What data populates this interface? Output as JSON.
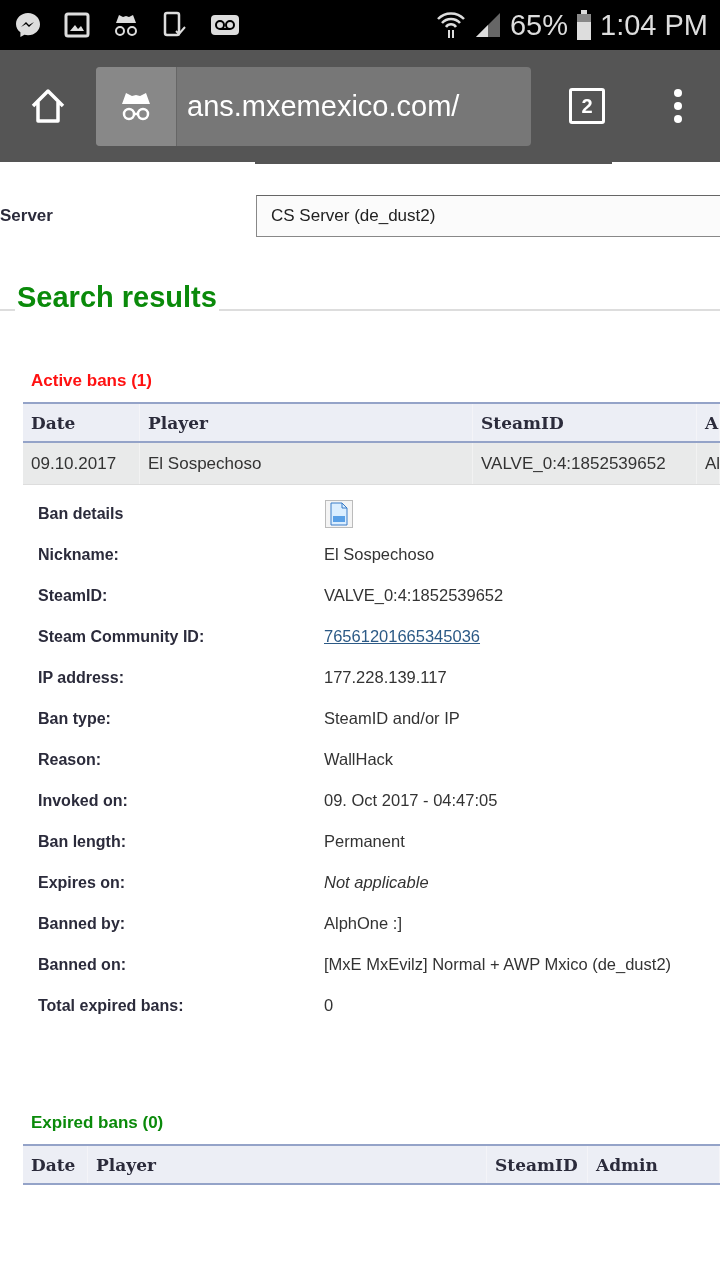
{
  "status_bar": {
    "battery": "65%",
    "time": "1:04 PM"
  },
  "browser": {
    "url": "ans.mxemexico.com/",
    "tab_count": "2"
  },
  "form": {
    "label": "Server",
    "value": "CS Server (de_dust2)"
  },
  "results": {
    "title": "Search results",
    "active": {
      "heading": "Active bans (1)",
      "columns": [
        "Date",
        "Player",
        "SteamID",
        "A"
      ],
      "rows": [
        {
          "cells": [
            "09.10.2017",
            "El Sospechoso",
            "VALVE_0:4:1852539652",
            "Al"
          ]
        }
      ]
    },
    "details": [
      {
        "label": "Ban details",
        "kind": "icon"
      },
      {
        "label": "Nickname:",
        "value": "El Sospechoso",
        "kind": "text"
      },
      {
        "label": "SteamID:",
        "value": "VALVE_0:4:1852539652",
        "kind": "text"
      },
      {
        "label": "Steam Community ID:",
        "value": "76561201665345036",
        "kind": "link"
      },
      {
        "label": "IP address:",
        "value": "177.228.139.117",
        "kind": "text"
      },
      {
        "label": "Ban type:",
        "value": "SteamID and/or IP",
        "kind": "text"
      },
      {
        "label": "Reason:",
        "value": "WallHack",
        "kind": "text"
      },
      {
        "label": "Invoked on:",
        "value": "09. Oct 2017 - 04:47:05",
        "kind": "text"
      },
      {
        "label": "Ban length:",
        "value": "Permanent",
        "kind": "text"
      },
      {
        "label": "Expires on:",
        "value": "Not applicable",
        "kind": "italic"
      },
      {
        "label": "Banned by:",
        "value": "AlphOne :]",
        "kind": "text"
      },
      {
        "label": "Banned on:",
        "value": "[MxE MxEvilz] Normal + AWP Mxico (de_dust2)",
        "kind": "text"
      },
      {
        "label": "Total expired bans:",
        "value": "0",
        "kind": "text"
      }
    ],
    "expired": {
      "heading": "Expired bans (0)",
      "columns": [
        "Date",
        "Player",
        "SteamID",
        "Admin"
      ]
    }
  }
}
